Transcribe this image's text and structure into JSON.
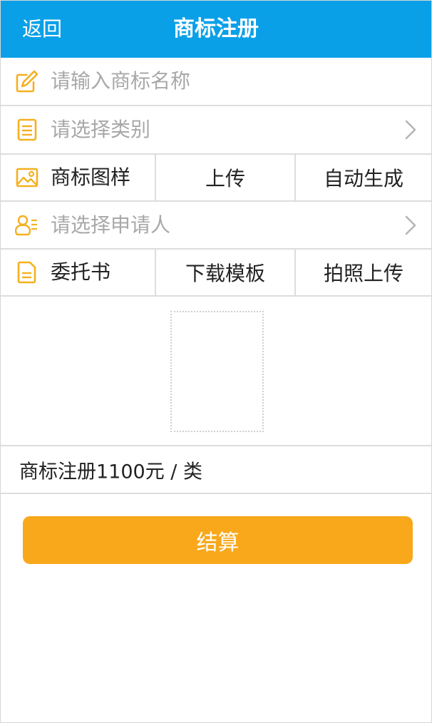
{
  "header": {
    "back_label": "返回",
    "title": "商标注册",
    "bg_color": "#0aa0e8"
  },
  "form": {
    "name": {
      "icon": "pencil-edit-icon",
      "placeholder": "请输入商标名称"
    },
    "category": {
      "icon": "list-icon",
      "placeholder": "请选择类别"
    },
    "sample": {
      "icon": "image-icon",
      "label": "商标图样",
      "upload_label": "上传",
      "auto_label": "自动生成"
    },
    "applicant": {
      "icon": "person-list-icon",
      "placeholder": "请选择申请人"
    },
    "authorization": {
      "icon": "document-icon",
      "label": "委托书",
      "download_label": "下载模板",
      "photo_label": "拍照上传"
    }
  },
  "price": {
    "text": "商标注册1100元 / 类"
  },
  "checkout": {
    "label": "结算",
    "color": "#f8a81a"
  },
  "colors": {
    "icon_accent": "#f5b020",
    "divider": "#dddddd",
    "placeholder": "#a8a8a8"
  }
}
